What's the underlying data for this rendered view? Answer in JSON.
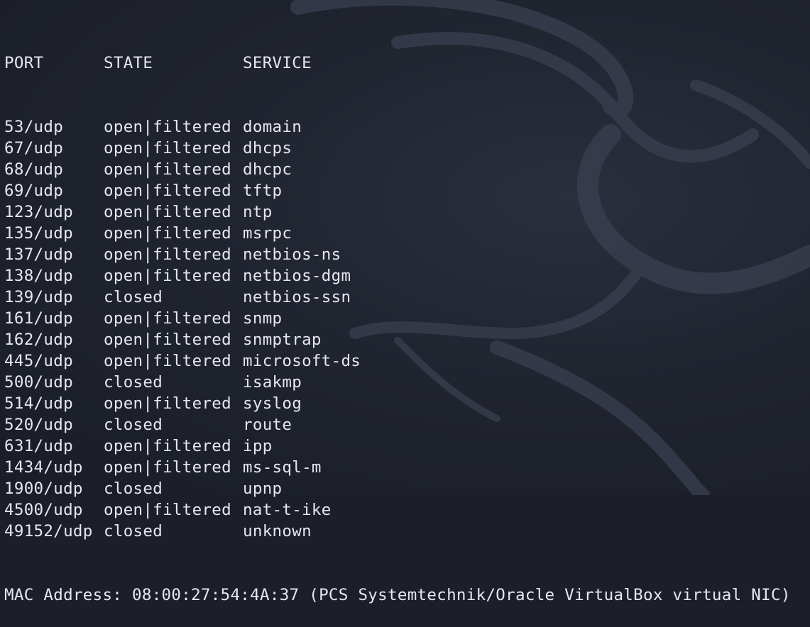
{
  "terminal": {
    "header": {
      "port": "PORT",
      "state": "STATE",
      "service": "SERVICE"
    },
    "rows": [
      {
        "port": "53/udp",
        "state": "open|filtered",
        "service": "domain"
      },
      {
        "port": "67/udp",
        "state": "open|filtered",
        "service": "dhcps"
      },
      {
        "port": "68/udp",
        "state": "open|filtered",
        "service": "dhcpc"
      },
      {
        "port": "69/udp",
        "state": "open|filtered",
        "service": "tftp"
      },
      {
        "port": "123/udp",
        "state": "open|filtered",
        "service": "ntp"
      },
      {
        "port": "135/udp",
        "state": "open|filtered",
        "service": "msrpc"
      },
      {
        "port": "137/udp",
        "state": "open|filtered",
        "service": "netbios-ns"
      },
      {
        "port": "138/udp",
        "state": "open|filtered",
        "service": "netbios-dgm"
      },
      {
        "port": "139/udp",
        "state": "closed",
        "service": "netbios-ssn"
      },
      {
        "port": "161/udp",
        "state": "open|filtered",
        "service": "snmp"
      },
      {
        "port": "162/udp",
        "state": "open|filtered",
        "service": "snmptrap"
      },
      {
        "port": "445/udp",
        "state": "open|filtered",
        "service": "microsoft-ds"
      },
      {
        "port": "500/udp",
        "state": "closed",
        "service": "isakmp"
      },
      {
        "port": "514/udp",
        "state": "open|filtered",
        "service": "syslog"
      },
      {
        "port": "520/udp",
        "state": "closed",
        "service": "route"
      },
      {
        "port": "631/udp",
        "state": "open|filtered",
        "service": "ipp"
      },
      {
        "port": "1434/udp",
        "state": "open|filtered",
        "service": "ms-sql-m"
      },
      {
        "port": "1900/udp",
        "state": "closed",
        "service": "upnp"
      },
      {
        "port": "4500/udp",
        "state": "open|filtered",
        "service": "nat-t-ike"
      },
      {
        "port": "49152/udp",
        "state": "closed",
        "service": "unknown"
      }
    ],
    "mac_line": "MAC Address: 08:00:27:54:4A:37 (PCS Systemtechnik/Oracle VirtualBox virtual NIC)"
  },
  "colors": {
    "background": "#1c1f2a",
    "text": "#e6e8ee",
    "wallpaper_accent": "#3a4050"
  },
  "wallpaper": {
    "icon": "kali-dragon-icon"
  }
}
